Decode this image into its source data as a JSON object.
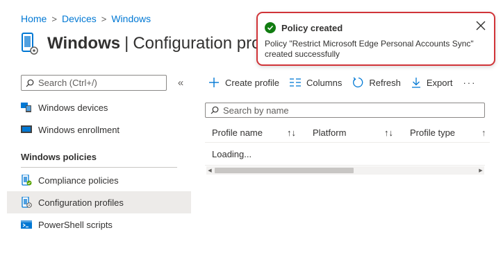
{
  "breadcrumb": [
    "Home",
    "Devices",
    "Windows"
  ],
  "page": {
    "title_bold": "Windows",
    "title_rest": "Configuration profiles"
  },
  "sidebar": {
    "search_placeholder": "Search (Ctrl+/)",
    "collapse_glyph": "«",
    "items_top": [
      {
        "label": "Windows devices",
        "icon": "devices-icon"
      },
      {
        "label": "Windows enrollment",
        "icon": "enrollment-icon"
      }
    ],
    "section_title": "Windows policies",
    "items_policies": [
      {
        "label": "Compliance policies",
        "icon": "compliance-icon"
      },
      {
        "label": "Configuration profiles",
        "icon": "configuration-icon",
        "selected": true
      },
      {
        "label": "PowerShell scripts",
        "icon": "powershell-icon"
      }
    ]
  },
  "toolbar": {
    "create": "Create profile",
    "columns": "Columns",
    "refresh": "Refresh",
    "export": "Export",
    "more": "···"
  },
  "grid": {
    "search_placeholder": "Search by name",
    "columns": [
      "Profile name",
      "Platform",
      "Profile type"
    ],
    "status": "Loading..."
  },
  "toast": {
    "title": "Policy created",
    "message": "Policy \"Restrict Microsoft Edge Personal Accounts Sync\" created successfully"
  },
  "colors": {
    "accent": "#0078d4",
    "success": "#107c10",
    "highlight_border": "#d13438",
    "selected_bg": "#edebe9"
  }
}
